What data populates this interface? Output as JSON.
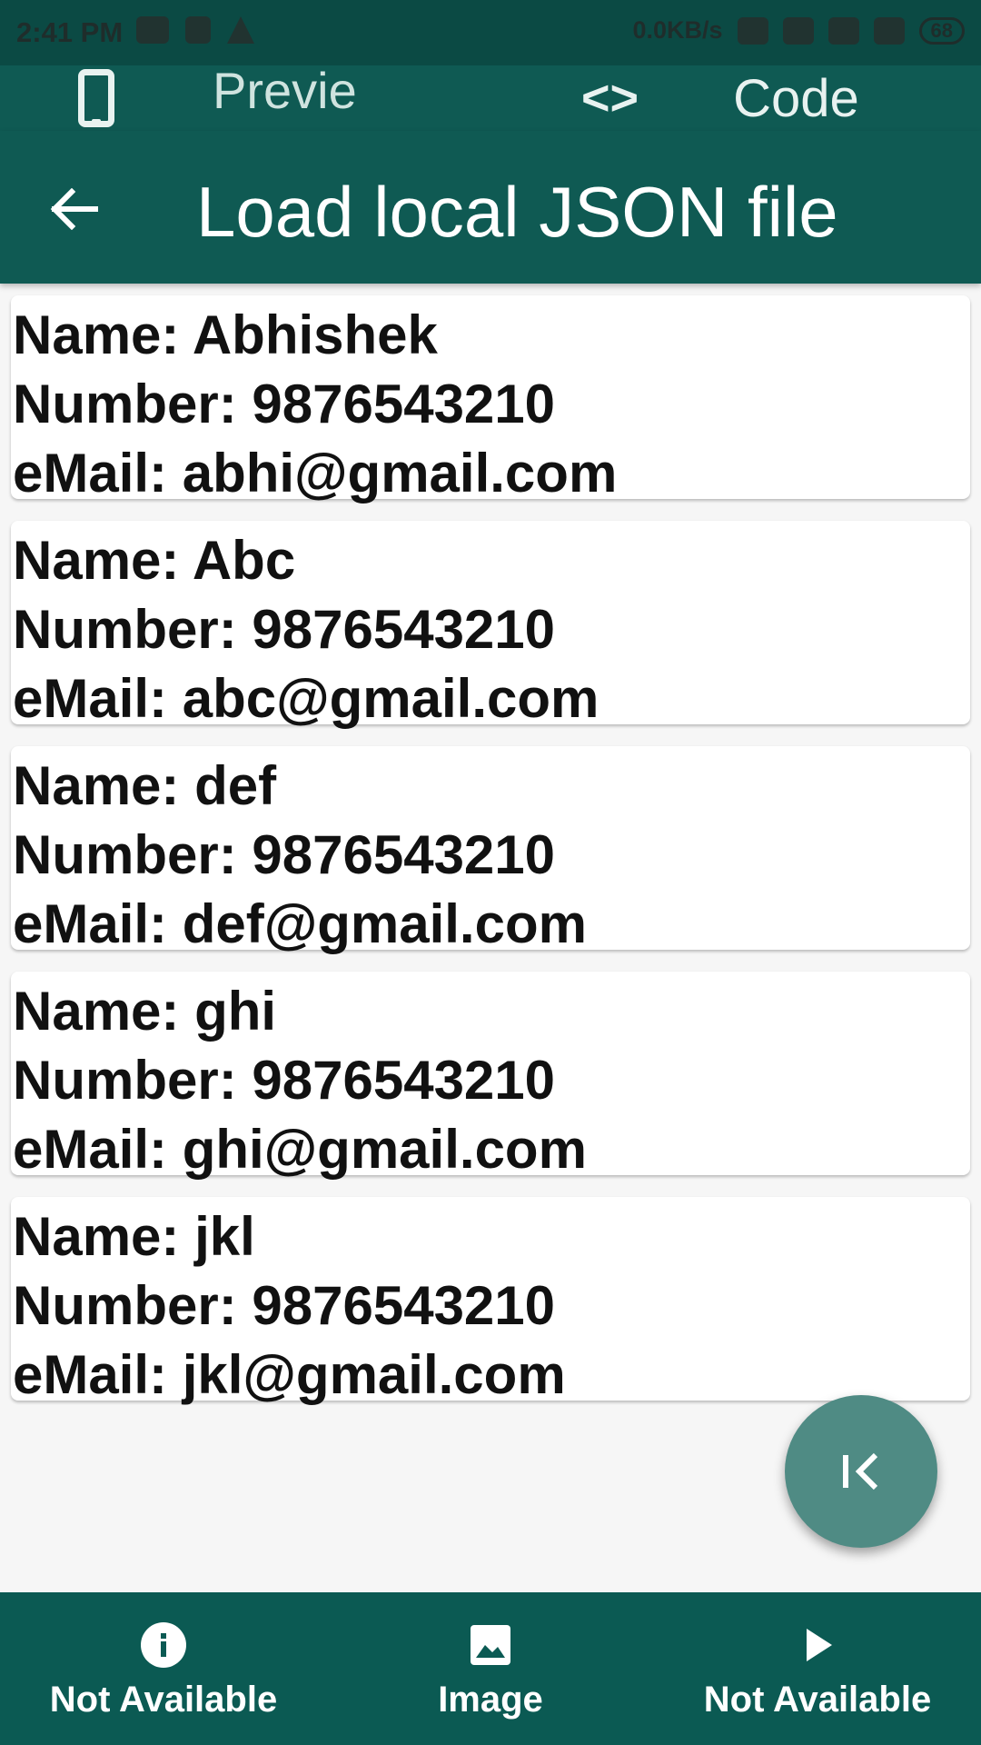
{
  "status_bar": {
    "time": "2:41 PM",
    "speed": "0.0KB/s",
    "battery": "68",
    "icons_left": [
      "youtube-icon",
      "trash-icon",
      "warning-icon"
    ],
    "icons_right": [
      "mute-icon",
      "alarm-icon",
      "volte-icon",
      "signal-icon"
    ]
  },
  "tabs": {
    "preview_label": "Preview",
    "code_label": "Code"
  },
  "app_bar": {
    "title": "Load local JSON file",
    "back_icon": "arrow-back-icon"
  },
  "contacts": [
    {
      "name": "Name: Abhishek",
      "number": "Number: 9876543210",
      "email": "eMail: abhi@gmail.com"
    },
    {
      "name": "Name: Abc",
      "number": "Number: 9876543210",
      "email": "eMail: abc@gmail.com"
    },
    {
      "name": "Name: def",
      "number": "Number: 9876543210",
      "email": "eMail: def@gmail.com"
    },
    {
      "name": "Name: ghi",
      "number": "Number: 9876543210",
      "email": "eMail: ghi@gmail.com"
    },
    {
      "name": "Name: jkl",
      "number": "Number: 9876543210",
      "email": "eMail: jkl@gmail.com"
    }
  ],
  "fab": {
    "icon": "first-page-icon"
  },
  "bottom_nav": [
    {
      "label": "Not Available",
      "icon": "info-icon"
    },
    {
      "label": "Image",
      "icon": "image-icon"
    },
    {
      "label": "Not Available",
      "icon": "play-icon"
    }
  ],
  "colors": {
    "primary": "#0f5a53",
    "status_bar": "#0b4a44",
    "fab": "#4f8b84",
    "background": "#f6f6f6"
  }
}
